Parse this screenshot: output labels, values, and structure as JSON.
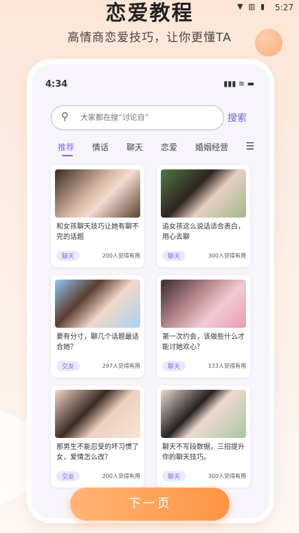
{
  "status_bar": {
    "time": "5:27",
    "icons": "▼ ▥ ▮"
  },
  "header": {
    "title": "恋爱教程",
    "subtitle": "高情商恋爱技巧，让你更懂TA"
  },
  "phone": {
    "time": "4:34",
    "status_icons": "▮▮▮ ≋ ▬",
    "search": {
      "placeholder": "大家都在搜“讨论自”",
      "button_label": "搜索"
    },
    "tabs": [
      "推荐",
      "情话",
      "聊天",
      "恋爱",
      "婚姻经营"
    ],
    "active_tab": 0,
    "cards": [
      {
        "title": "和女孩聊天技巧让她有聊不完的话题",
        "tag": "聊天",
        "count": "200人觉得有用",
        "image": "woman-long-dark-hair"
      },
      {
        "title": "追女孩这么说话适合表白，用心去聊",
        "tag": "聊天",
        "count": "300人觉得有用",
        "image": "woman-green-garden"
      },
      {
        "title": "要有分寸，聊几个话题最适合她？",
        "tag": "交友",
        "count": "297人觉得有用",
        "image": "woman-blue-sky"
      },
      {
        "title": "第一次约会，该做些什么才能讨她欢心？",
        "tag": "聊天",
        "count": "133人觉得有用",
        "image": "woman-pink-flowers"
      },
      {
        "title": "那男生不能忍受的坏习惯了女，爱情怎么改？",
        "tag": "交友",
        "count": "200人觉得有用",
        "image": "woman-beach-sunset"
      },
      {
        "title": "聊天不写段数据，三招提升你的聊天技巧。",
        "tag": "聊天",
        "count": "300人觉得有用",
        "image": "woman-green-dress"
      }
    ]
  },
  "next_button": {
    "label": "下一页"
  },
  "colors": {
    "accent": "#7b6cf0",
    "button": "#ff9442"
  }
}
